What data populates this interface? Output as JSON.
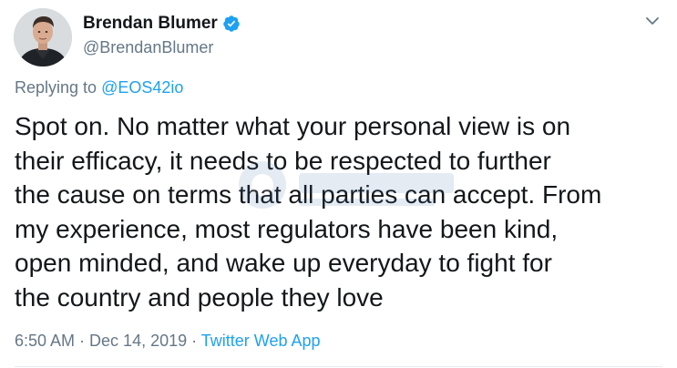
{
  "tweet": {
    "author": {
      "display_name": "Brendan Blumer",
      "handle": "@BrendanBlumer",
      "verified": true
    },
    "reply": {
      "prefix": "Replying to ",
      "handle": "@EOS42io"
    },
    "text": "Spot on. No matter what your personal view is on\ntheir efficacy, it needs to be respected to further\nthe cause on terms that all parties can accept. From\nmy experience, most regulators have been kind,\nopen minded, and wake up everyday to fight for\nthe country and people they love",
    "timestamp": {
      "time": "6:50 AM",
      "separator1": " · ",
      "date": "Dec 14, 2019",
      "separator2": " · ",
      "source": "Twitter Web App"
    }
  },
  "icons": {
    "verified": "verified-badge-icon",
    "menu": "chevron-down-icon"
  },
  "colors": {
    "link": "#1da1f2",
    "secondary_text": "#657786",
    "primary_text": "#14171a"
  }
}
